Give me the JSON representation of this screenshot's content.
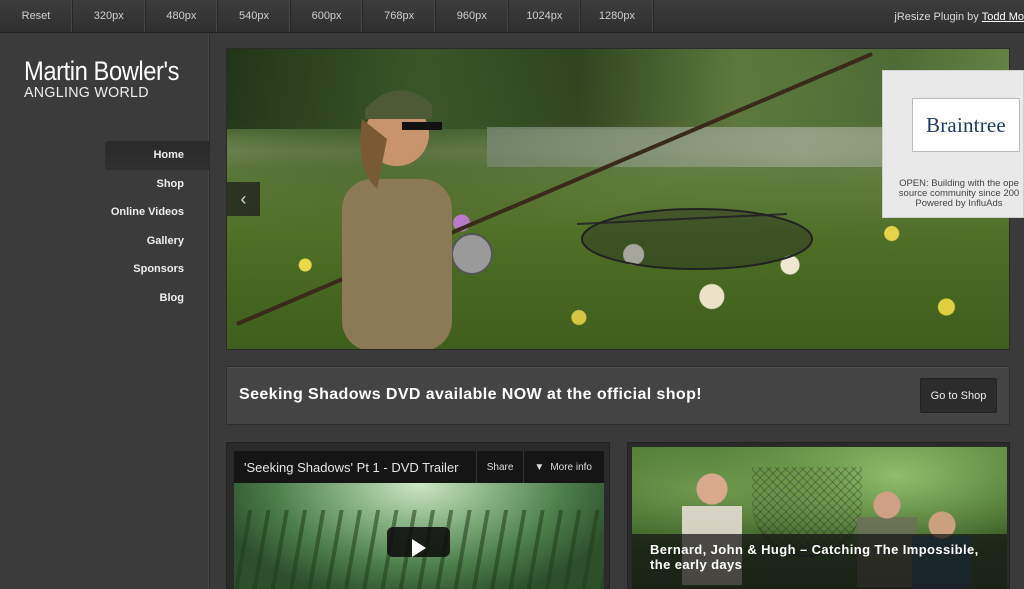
{
  "topbar": {
    "reset": "Reset",
    "widths": [
      "320px",
      "480px",
      "540px",
      "600px",
      "768px",
      "960px",
      "1024px",
      "1280px"
    ],
    "credit_prefix": "jResize Plugin by",
    "credit_author": "Todd Mo"
  },
  "logo": {
    "line1": "Martin Bowler's",
    "line2": "ANGLING WORLD"
  },
  "nav": {
    "items": [
      "Home",
      "Shop",
      "Online Videos",
      "Gallery",
      "Sponsors",
      "Blog"
    ],
    "active": "Home"
  },
  "hero": {
    "prev_icon": "chevron-left-icon",
    "prev_glyph": "‹"
  },
  "ad": {
    "brand": "Braintree",
    "text_line1": "OPEN: Building with the ope",
    "text_line2": "source community since 200",
    "text_line3": "Powered by InfluAds"
  },
  "promo": {
    "message": "Seeking Shadows DVD available NOW at the official shop!",
    "button": "Go to Shop"
  },
  "video": {
    "title": "'Seeking Shadows' Pt 1 - DVD Trailer",
    "share": "Share",
    "more_info": "More info",
    "more_icon": "▼"
  },
  "feature": {
    "caption": "Bernard, John & Hugh – Catching The Impossible, the early days"
  },
  "colors": {
    "background": "#3a3a3a",
    "sidebar": "#3b3b3b",
    "panel": "#444444",
    "button": "#2c2c2c"
  }
}
